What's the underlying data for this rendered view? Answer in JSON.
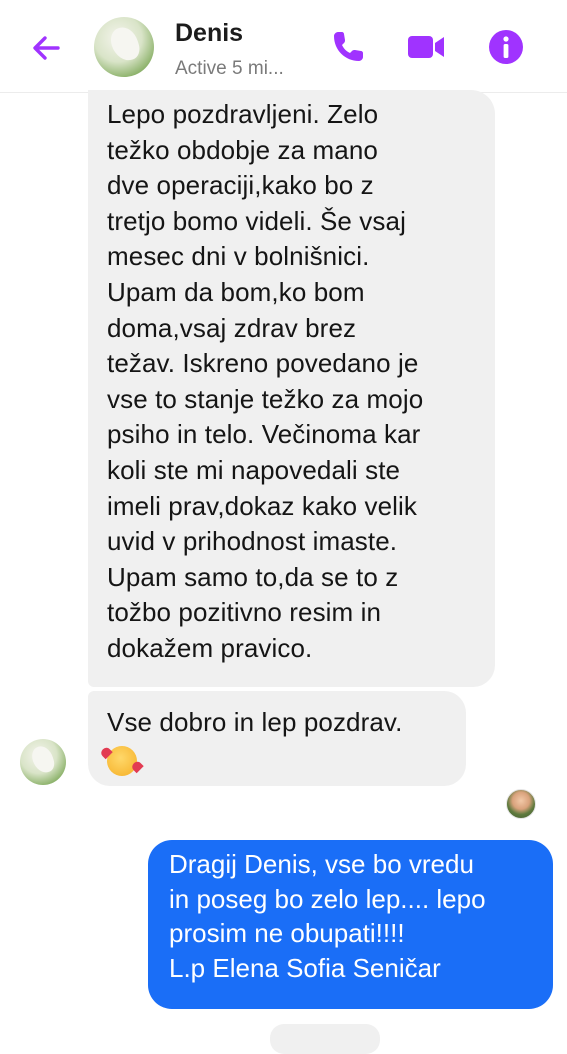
{
  "header": {
    "contact_name": "Denis",
    "status": "Active 5 mi...",
    "accent_color": "#a033ff",
    "icons": [
      "back-arrow-icon",
      "phone-icon",
      "video-camera-icon",
      "info-icon"
    ]
  },
  "messages": [
    {
      "direction": "incoming",
      "text": "Lepo pozdravljeni. Zelo\ntežko obdobje za mano\ndve operaciji,kako bo z\ntretjo bomo videli. Še vsaj\nmesec dni v bolnišnici.\nUpam da bom,ko bom\ndoma,vsaj zdrav brez\ntežav. Iskreno povedano je\nvse to stanje težko za mojo\npsiho in telo. Večinoma kar\nkoli ste mi napovedali ste\nimeli prav,dokaz kako velik\nuvid v prihodnost imaste.\nUpam samo to,da se to z\ntožbo pozitivno resim in\ndokažem pravico."
    },
    {
      "direction": "incoming",
      "text": "Vse dobro in lep pozdrav.",
      "emoji": "smiling-face-with-hearts"
    },
    {
      "direction": "outgoing",
      "text": "Dragij Denis,  vse bo vredu\nin poseg bo zelo lep.... lepo\nprosim ne obupati!!!!\nL.p Elena Sofia Seničar"
    }
  ],
  "colors": {
    "incoming_bubble": "#f0f0f0",
    "outgoing_bubble": "#1a6ef7"
  }
}
